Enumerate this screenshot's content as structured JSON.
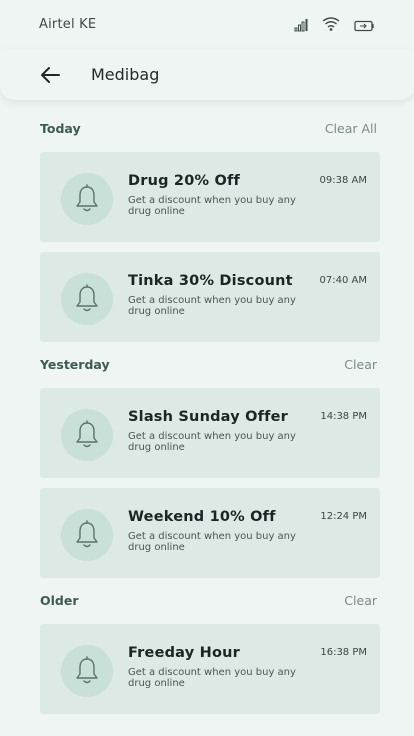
{
  "status_bar": {
    "carrier": "Airtel KE",
    "icons": [
      "signal-icon",
      "wifi-icon",
      "battery-icon"
    ]
  },
  "header": {
    "title": "Medibag"
  },
  "sections": [
    {
      "title": "Today",
      "action": "Clear All",
      "items": [
        {
          "title": "Drug 20% Off",
          "body": "Get a discount when you buy any drug online",
          "time": "09:38 AM"
        },
        {
          "title": "Tinka 30% Discount",
          "body": "Get a discount when you buy any drug online",
          "time": "07:40 AM"
        }
      ]
    },
    {
      "title": "Yesterday",
      "action": "Clear",
      "items": [
        {
          "title": "Slash Sunday Offer",
          "body": "Get a discount when you buy any drug online",
          "time": "14:38 PM"
        },
        {
          "title": "Weekend 10% Off",
          "body": "Get a discount when you buy any drug online",
          "time": "12:24 PM"
        }
      ]
    },
    {
      "title": "Older",
      "action": "Clear",
      "items": [
        {
          "title": "Freeday Hour",
          "body": "Get a discount when you buy any drug online",
          "time": "16:38 PM"
        }
      ]
    }
  ],
  "colors": {
    "background": "#eef5f3",
    "card": "#dde9e5",
    "bell_circle": "#c8e0d8",
    "section_title": "#3d5a53"
  }
}
